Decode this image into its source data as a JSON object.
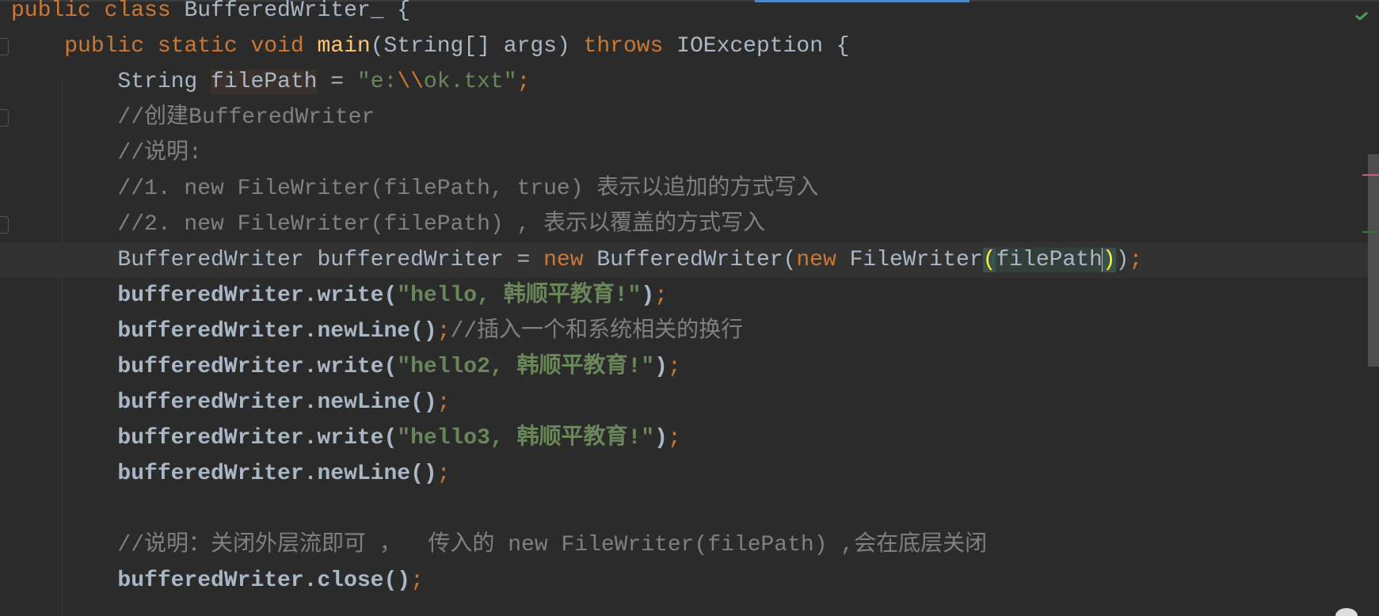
{
  "editor": {
    "status_icon": "inspection-ok-check-icon",
    "colors": {
      "background": "#2b2b2b",
      "keyword": "#cc7832",
      "string": "#6a8759",
      "comment": "#808080",
      "text": "#a9b7c6",
      "method": "#ffc66d",
      "tab_accent": "#4a88c7"
    },
    "lines": [
      {
        "tokens": [
          {
            "t": "public class ",
            "c": "kw"
          },
          {
            "t": "BufferedWriter_ {",
            "c": ""
          }
        ]
      },
      {
        "tokens": [
          {
            "t": "    ",
            "c": ""
          },
          {
            "t": "public static void ",
            "c": "kw"
          },
          {
            "t": "main",
            "c": "fn"
          },
          {
            "t": "(String[] args) ",
            "c": ""
          },
          {
            "t": "throws ",
            "c": "kw"
          },
          {
            "t": "IOException {",
            "c": ""
          }
        ]
      },
      {
        "tokens": [
          {
            "t": "        String ",
            "c": ""
          },
          {
            "t": "filePath",
            "c": "varhl"
          },
          {
            "t": " = ",
            "c": ""
          },
          {
            "t": "\"e:",
            "c": "str"
          },
          {
            "t": "\\\\",
            "c": "esc"
          },
          {
            "t": "ok.txt\"",
            "c": "str"
          },
          {
            "t": ";",
            "c": "kw"
          }
        ]
      },
      {
        "tokens": [
          {
            "t": "        //创建BufferedWriter",
            "c": "cm"
          }
        ]
      },
      {
        "tokens": [
          {
            "t": "        //说明:",
            "c": "cm"
          }
        ]
      },
      {
        "tokens": [
          {
            "t": "        //1. new FileWriter(filePath, true) 表示以追加的方式写入",
            "c": "cm"
          }
        ]
      },
      {
        "tokens": [
          {
            "t": "        //2. new FileWriter(filePath) , 表示以覆盖的方式写入",
            "c": "cm"
          }
        ]
      },
      {
        "current": true,
        "tokens": [
          {
            "t": "        BufferedWriter bufferedWriter = ",
            "c": ""
          },
          {
            "t": "new ",
            "c": "kw"
          },
          {
            "t": "BufferedWriter(",
            "c": ""
          },
          {
            "t": "new ",
            "c": "kw"
          },
          {
            "t": "FileWriter",
            "c": ""
          },
          {
            "t": "(",
            "c": "brace"
          },
          {
            "t": "filePath",
            "c": "argbg"
          },
          {
            "t": "caret",
            "c": "caret"
          },
          {
            "t": ")",
            "c": "brace"
          },
          {
            "t": ")",
            "c": ""
          },
          {
            "t": ";",
            "c": "kw"
          }
        ]
      },
      {
        "tokens": [
          {
            "t": "        bufferedWriter.write(",
            "c": "bold"
          },
          {
            "t": "\"hello, 韩顺平教育!\"",
            "c": "str bold"
          },
          {
            "t": ")",
            "c": "bold"
          },
          {
            "t": ";",
            "c": "kw"
          }
        ]
      },
      {
        "tokens": [
          {
            "t": "        bufferedWriter.newLine()",
            "c": "bold"
          },
          {
            "t": ";",
            "c": "kw"
          },
          {
            "t": "//插入一个和系统相关的换行",
            "c": "cm"
          }
        ]
      },
      {
        "tokens": [
          {
            "t": "        bufferedWriter.write(",
            "c": "bold"
          },
          {
            "t": "\"hello2, 韩顺平教育!\"",
            "c": "str bold"
          },
          {
            "t": ")",
            "c": "bold"
          },
          {
            "t": ";",
            "c": "kw"
          }
        ]
      },
      {
        "tokens": [
          {
            "t": "        bufferedWriter.newLine()",
            "c": "bold"
          },
          {
            "t": ";",
            "c": "kw"
          }
        ]
      },
      {
        "tokens": [
          {
            "t": "        bufferedWriter.write(",
            "c": "bold"
          },
          {
            "t": "\"hello3, 韩顺平教育!\"",
            "c": "str bold"
          },
          {
            "t": ")",
            "c": "bold"
          },
          {
            "t": ";",
            "c": "kw"
          }
        ]
      },
      {
        "tokens": [
          {
            "t": "        bufferedWriter.newLine()",
            "c": "bold"
          },
          {
            "t": ";",
            "c": "kw"
          }
        ]
      },
      {
        "tokens": [
          {
            "t": "",
            "c": ""
          }
        ]
      },
      {
        "tokens": [
          {
            "t": "        //说明：关闭外层流即可 ，  传入的 new FileWriter(filePath) ,会在底层关闭",
            "c": "cm"
          }
        ]
      },
      {
        "tokens": [
          {
            "t": "        bufferedWriter.close()",
            "c": "bold"
          },
          {
            "t": ";",
            "c": "kw"
          }
        ]
      }
    ]
  }
}
